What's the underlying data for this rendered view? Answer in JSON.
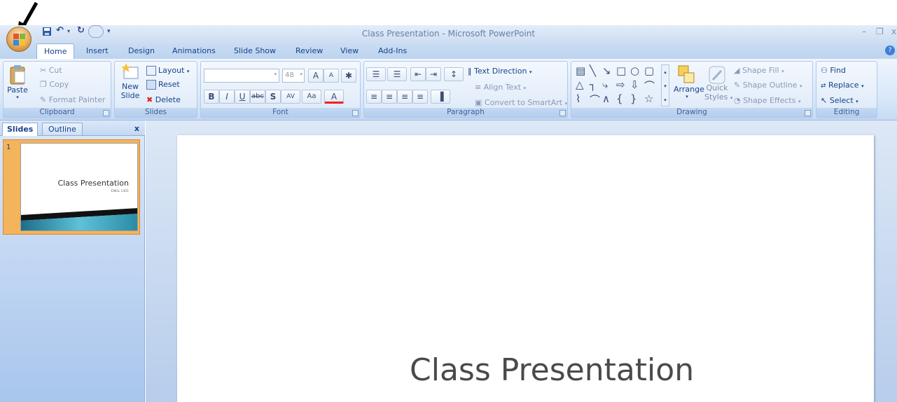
{
  "window": {
    "title": "Class Presentation - Microsoft PowerPoint"
  },
  "tabs": [
    "Home",
    "Insert",
    "Design",
    "Animations",
    "Slide Show",
    "Review",
    "View",
    "Add-Ins"
  ],
  "clipboard": {
    "label": "Clipboard",
    "paste": "Paste",
    "cut": "Cut",
    "copy": "Copy",
    "format_painter": "Format Painter"
  },
  "slides_group": {
    "label": "Slides",
    "new_slide_1": "New",
    "new_slide_2": "Slide",
    "layout": "Layout",
    "reset": "Reset",
    "delete": "Delete"
  },
  "font": {
    "label": "Font",
    "size": "48",
    "grow": "A",
    "shrink": "A",
    "bold": "B",
    "italic": "I",
    "underline": "U",
    "strike": "abc",
    "shadow": "S",
    "spacing": "AV",
    "change_case": "Aa",
    "color": "A"
  },
  "paragraph": {
    "label": "Paragraph",
    "text_direction": "Text Direction",
    "align_text": "Align Text",
    "smartart": "Convert to SmartArt"
  },
  "drawing": {
    "label": "Drawing",
    "arrange": "Arrange",
    "quick_1": "Quick",
    "quick_2": "Styles",
    "shape_fill": "Shape Fill",
    "shape_outline": "Shape Outline",
    "shape_effects": "Shape Effects"
  },
  "editing": {
    "label": "Editing",
    "find": "Find",
    "replace": "Replace",
    "select": "Select"
  },
  "pane": {
    "slides_tab": "Slides",
    "outline_tab": "Outline",
    "close": "x",
    "slide_number": "1"
  },
  "thumbnail": {
    "title": "Class Presentation",
    "subtitle": "ENGL 1301"
  },
  "slide": {
    "title": "Class Presentation"
  }
}
